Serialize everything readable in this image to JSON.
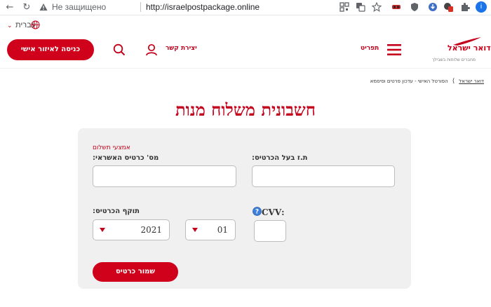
{
  "browser": {
    "security_text": "Не защищено",
    "url": "http://israelpostpackage.online"
  },
  "language": {
    "label": "עברית"
  },
  "header": {
    "login_button": "כניסה לאיזור אישי",
    "contact_label": "יצירת קשר",
    "menu_label": "תפריט",
    "logo_brand": "דואר ישראל",
    "logo_slogan": "מחברים שלוחות בשבילך"
  },
  "breadcrumb": {
    "home": "דואר ישראל",
    "current": "הפורטל האישי - עדכון פרטים וסיסמא"
  },
  "page": {
    "title": "חשבונית משלוח מנות"
  },
  "form": {
    "payment_methods_label": "אמצעי תשלום",
    "card_number_label": "מס' כרטיס האשראי:",
    "card_number_value": "",
    "id_label": "ת.ז בעל הכרטיס:",
    "id_value": "",
    "expiry_label": "תוקף הכרטיס:",
    "expiry_year": "2021",
    "expiry_month": "01",
    "cvv_label": ":CVV",
    "cvv_value": "",
    "save_button": "שמור כרטיס"
  },
  "colors": {
    "brand_red": "#d0021b",
    "panel_bg": "#f0f0f0"
  }
}
